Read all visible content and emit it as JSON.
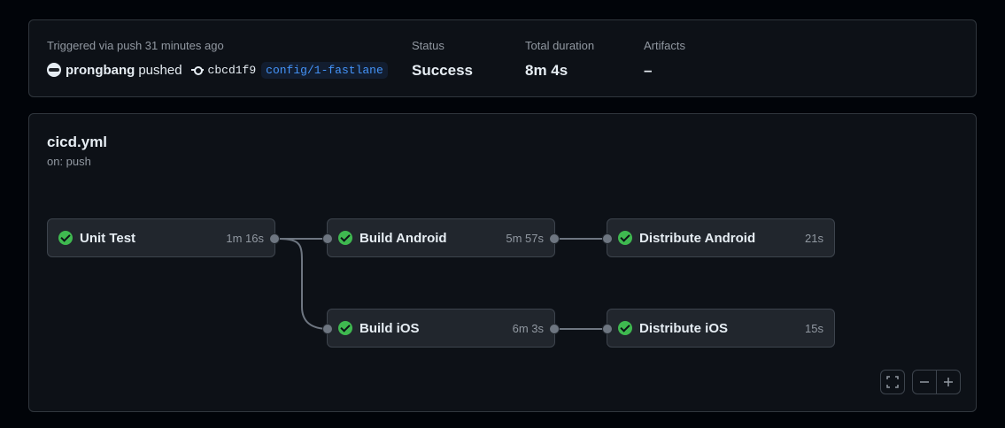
{
  "summary": {
    "trigger_text": "Triggered via push 31 minutes ago",
    "actor": "prongbang",
    "action": "pushed",
    "commit_sha": "cbcd1f9",
    "branch": "config/1-fastlane",
    "status_label": "Status",
    "status_value": "Success",
    "duration_label": "Total duration",
    "duration_value": "8m 4s",
    "artifacts_label": "Artifacts",
    "artifacts_value": "–"
  },
  "workflow": {
    "file": "cicd.yml",
    "trigger": "on: push",
    "jobs": [
      {
        "name": "Unit Test",
        "duration": "1m 16s",
        "status": "success"
      },
      {
        "name": "Build Android",
        "duration": "5m 57s",
        "status": "success"
      },
      {
        "name": "Distribute Android",
        "duration": "21s",
        "status": "success"
      },
      {
        "name": "Build iOS",
        "duration": "6m 3s",
        "status": "success"
      },
      {
        "name": "Distribute iOS",
        "duration": "15s",
        "status": "success"
      }
    ]
  },
  "controls": {
    "fullscreen_icon": "fullscreen-icon",
    "zoom_out_icon": "minus-icon",
    "zoom_in_icon": "plus-icon"
  },
  "colors": {
    "success": "#3fb950",
    "branch": "#4493f8",
    "background": "#0d1117"
  }
}
